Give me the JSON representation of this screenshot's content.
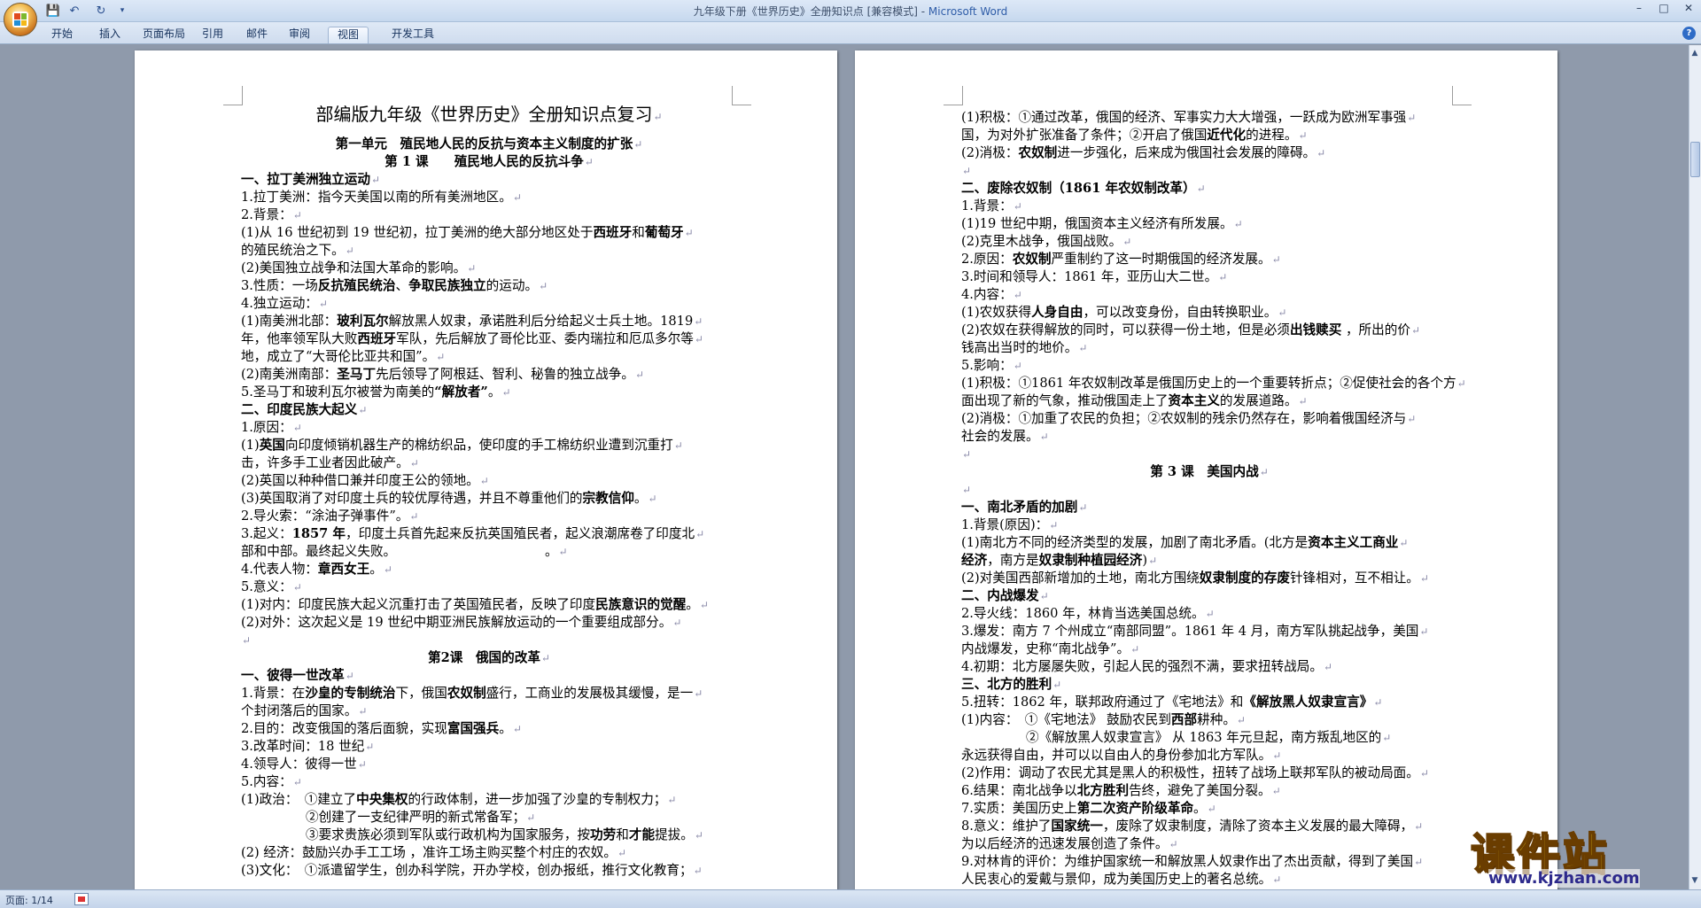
{
  "window": {
    "title": "九年级下册《世界历史》全册知识点 [兼容模式] - ",
    "app_name": "Microsoft Word",
    "minimize": "–",
    "maximize": "□",
    "close": "✕"
  },
  "qat": {
    "save_icon": "💾",
    "undo_icon": "↶",
    "redo_icon": "↻",
    "customize_icon": "▾"
  },
  "ribbon": {
    "tabs": [
      {
        "label": "开始"
      },
      {
        "label": "插入"
      },
      {
        "label": "页面布局"
      },
      {
        "label": "引用"
      },
      {
        "label": "邮件"
      },
      {
        "label": "审阅"
      },
      {
        "label": "视图"
      },
      {
        "label": "开发工具"
      }
    ],
    "active_tab": "视图",
    "help": "?"
  },
  "status": {
    "page": "页面: 1/14"
  },
  "watermark": {
    "main": "课件站",
    "url": "www.kjzhan.com"
  },
  "scroll": {
    "up": "▲",
    "down": "▼"
  },
  "left_page": {
    "title": "部编版九年级《世界历史》全册知识点复习",
    "lines": [
      [
        {
          "t": "第一单元　殖民地人民的反抗与资本主义制度的扩张",
          "b": true
        }
      ],
      [
        {
          "t": "第 1 课　　殖民地人民的反抗斗争",
          "b": true
        }
      ],
      [
        {
          "t": "一、拉丁美洲独立运动",
          "b": true
        }
      ],
      [
        {
          "t": "1.拉丁美洲：指今天美国以南的所有美洲地区。"
        }
      ],
      [
        {
          "t": "2.背景："
        }
      ],
      [
        {
          "t": "(1)从 16 世纪初到 19 世纪初，拉丁美洲的绝大部分地区处于"
        },
        {
          "t": "西班牙",
          "b": true
        },
        {
          "t": "和"
        },
        {
          "t": "葡萄牙",
          "b": true
        }
      ],
      [
        {
          "t": "的殖民统治之下。"
        }
      ],
      [
        {
          "t": "(2)美国独立战争和法国大革命的影响。"
        }
      ],
      [
        {
          "t": "3.性质：一场"
        },
        {
          "t": "反抗殖民统治",
          "b": true
        },
        {
          "t": "、"
        },
        {
          "t": "争取民族独立",
          "b": true
        },
        {
          "t": "的运动。"
        }
      ],
      [
        {
          "t": "4.独立运动："
        }
      ],
      [
        {
          "t": "(1)南美洲北部："
        },
        {
          "t": "玻利瓦尔",
          "b": true
        },
        {
          "t": "解放黑人奴隶，承诺胜利后分给起义士兵土地。1819"
        }
      ],
      [
        {
          "t": "年，他率领军队大败"
        },
        {
          "t": "西班牙",
          "b": true
        },
        {
          "t": "军队，先后解放了哥伦比亚、委内瑞拉和厄瓜多尔等"
        }
      ],
      [
        {
          "t": "地，成立了“大哥伦比亚共和国”。"
        }
      ],
      [
        {
          "t": "(2)南美洲南部："
        },
        {
          "t": "圣马丁",
          "b": true
        },
        {
          "t": "先后领导了阿根廷、智利、秘鲁的独立战争。"
        }
      ],
      [
        {
          "t": "5.圣马丁和玻利瓦尔被誉为南美的"
        },
        {
          "t": "“解放者”",
          "b": true
        },
        {
          "t": "。"
        }
      ],
      [
        {
          "t": "二、印度民族大起义",
          "b": true
        }
      ],
      [
        {
          "t": "1.原因："
        }
      ],
      [
        {
          "t": "(1)"
        },
        {
          "t": "英国",
          "b": true
        },
        {
          "t": "向印度倾销机器生产的棉纺织品，使印度的手工棉纺织业遭到沉重打"
        }
      ],
      [
        {
          "t": "击，许多手工业者因此破产。"
        }
      ],
      [
        {
          "t": "(2)英国以种种借口兼并印度王公的领地。"
        }
      ],
      [
        {
          "t": "(3)英国取消了对印度土兵的较优厚待遇，并且不尊重他们的"
        },
        {
          "t": "宗教信仰",
          "b": true
        },
        {
          "t": "。"
        }
      ],
      [
        {
          "t": "2.导火索：“涂油子弹事件”。"
        }
      ],
      [
        {
          "t": "3.起义："
        },
        {
          "t": "1857 年",
          "b": true
        },
        {
          "t": "，印度土兵首先起来反抗英国殖民者，起义浪潮席卷了印度北"
        }
      ],
      [
        {
          "t": "部和中部。最终起义失败。　　　　　　　　　　　　。"
        }
      ],
      [
        {
          "t": "4.代表人物："
        },
        {
          "t": "章西女王",
          "b": true
        },
        {
          "t": "。"
        }
      ],
      [
        {
          "t": "5.意义："
        }
      ],
      [
        {
          "t": "(1)对内：印度民族大起义沉重打击了英国殖民者，反映了印度"
        },
        {
          "t": "民族意识的觉醒",
          "b": true
        },
        {
          "t": "。"
        }
      ],
      [
        {
          "t": "(2)对外：这次起义是 19 世纪中期亚洲民族解放运动的一个重要组成部分。"
        }
      ],
      [],
      [
        {
          "t": "第2课　俄国的改革",
          "b": true
        }
      ],
      [
        {
          "t": "一、彼得一世改革",
          "b": true
        }
      ],
      [
        {
          "t": "1.背景：在"
        },
        {
          "t": "沙皇的专制统治",
          "b": true
        },
        {
          "t": "下，俄国"
        },
        {
          "t": "农奴制",
          "b": true
        },
        {
          "t": "盛行，工商业的发展极其缓慢，是一"
        }
      ],
      [
        {
          "t": "个封闭落后的国家。"
        }
      ],
      [
        {
          "t": "2.目的：改变俄国的落后面貌，实现"
        },
        {
          "t": "富国强兵",
          "b": true
        },
        {
          "t": "。"
        }
      ],
      [
        {
          "t": "3.改革时间：18 世纪"
        }
      ],
      [
        {
          "t": "4.领导人：彼得一世"
        }
      ],
      [
        {
          "t": "5.内容："
        }
      ],
      [
        {
          "t": "(1)政治：　①建立了"
        },
        {
          "t": "中央集权",
          "b": true
        },
        {
          "t": "的行政体制，进一步加强了沙皇的专制权力；"
        }
      ],
      [
        {
          "t": "　　　　　②创建了一支纪律严明的新式常备军；"
        }
      ],
      [
        {
          "t": "　　　　　③要求贵族必须到军队或行政机构为国家服务，按"
        },
        {
          "t": "功劳",
          "b": true
        },
        {
          "t": "和"
        },
        {
          "t": "才能",
          "b": true
        },
        {
          "t": "提拔。"
        }
      ],
      [
        {
          "t": "(2) 经济：鼓励兴办手工工场 ，准许工场主购买整个村庄的农奴。"
        }
      ],
      [
        {
          "t": "(3)文化：　①派遣留学生，创办科学院，开办学校，创办报纸，推行文化教育；"
        }
      ]
    ],
    "centered": [
      0,
      1,
      29
    ]
  },
  "right_page": {
    "lines": [
      [
        {
          "t": "(1)积极：①通过改革，俄国的经济、军事实力大大增强，一跃成为欧洲军事强"
        }
      ],
      [
        {
          "t": "国，为对外扩张准备了条件；②开启了俄国"
        },
        {
          "t": "近代化",
          "b": true
        },
        {
          "t": "的进程。"
        }
      ],
      [
        {
          "t": "(2)消极："
        },
        {
          "t": "农奴制",
          "b": true
        },
        {
          "t": "进一步强化，后来成为俄国社会发展的障碍。"
        }
      ],
      [],
      [
        {
          "t": "二、废除农奴制（1861 年农奴制改革）",
          "b": true
        }
      ],
      [
        {
          "t": "1.背景："
        }
      ],
      [
        {
          "t": "(1)19 世纪中期，俄国资本主义经济有所发展。"
        }
      ],
      [
        {
          "t": "(2)克里木战争，俄国战败。"
        }
      ],
      [
        {
          "t": "2.原因："
        },
        {
          "t": "农奴制",
          "b": true
        },
        {
          "t": "严重制约了这一时期俄国的经济发展。"
        }
      ],
      [
        {
          "t": "3.时间和领导人：1861 年，亚历山大二世。"
        }
      ],
      [
        {
          "t": "4.内容："
        }
      ],
      [
        {
          "t": "(1)农奴获得"
        },
        {
          "t": "人身自由",
          "b": true
        },
        {
          "t": "，可以改变身份，自由转换职业。"
        }
      ],
      [
        {
          "t": "(2)农奴在获得解放的同时，可以获得一份土地，但是必须"
        },
        {
          "t": "出钱赎买",
          "b": true
        },
        {
          "t": " ，所出的价"
        }
      ],
      [
        {
          "t": "钱高出当时的地价。"
        }
      ],
      [
        {
          "t": "5.影响："
        }
      ],
      [
        {
          "t": "(1)积极：①1861 年农奴制改革是俄国历史上的一个重要转折点；②促使社会的各个方"
        }
      ],
      [
        {
          "t": "面出现了新的气象，推动俄国走上了"
        },
        {
          "t": "资本主义",
          "b": true
        },
        {
          "t": "的发展道路。"
        }
      ],
      [
        {
          "t": "(2)消极：①加重了农民的负担；②农奴制的残余仍然存在，影响着俄国经济与"
        }
      ],
      [
        {
          "t": "社会的发展。"
        }
      ],
      [],
      [
        {
          "t": "第 3 课　美国内战",
          "b": true
        }
      ],
      [],
      [
        {
          "t": "一、南北矛盾的加剧",
          "b": true
        }
      ],
      [
        {
          "t": "1.背景(原因)："
        }
      ],
      [
        {
          "t": "(1)南北方不同的经济类型的发展，加剧了南北矛盾。(北方是"
        },
        {
          "t": "资本主义工商业",
          "b": true
        }
      ],
      [
        {
          "t": "经济",
          "b": true
        },
        {
          "t": "，南方是"
        },
        {
          "t": "奴隶制种植园经济",
          "b": true
        },
        {
          "t": ")"
        }
      ],
      [
        {
          "t": "(2)对美国西部新增加的土地，南北方围绕"
        },
        {
          "t": "奴隶制度的存废",
          "b": true
        },
        {
          "t": "针锋相对，互不相让。"
        }
      ],
      [
        {
          "t": "二、内战爆发",
          "b": true
        }
      ],
      [
        {
          "t": "2.导火线：1860 年，林肯当选美国总统。"
        }
      ],
      [
        {
          "t": "3.爆发：南方 7 个州成立“南部同盟”。1861 年 4 月，南方军队挑起战争，美国"
        }
      ],
      [
        {
          "t": "内战爆发，史称“南北战争”。"
        }
      ],
      [
        {
          "t": "4.初期：北方屡屡失败，引起人民的强烈不满，要求扭转战局。"
        }
      ],
      [
        {
          "t": "三、北方的胜利",
          "b": true
        }
      ],
      [
        {
          "t": "5.扭转：1862 年，联邦政府通过了《宅地法》和"
        },
        {
          "t": "《解放黑人奴隶宣言》",
          "b": true
        }
      ],
      [
        {
          "t": "(1)内容：　①《宅地法》 鼓励农民到"
        },
        {
          "t": "西部",
          "b": true
        },
        {
          "t": "耕种。"
        }
      ],
      [
        {
          "t": "　　　　　②《解放黑人奴隶宣言》 从 1863 年元旦起，南方叛乱地区的"
        }
      ],
      [
        {
          "t": "永远获得自由，并可以以自由人的身份参加北方军队。"
        }
      ],
      [
        {
          "t": "(2)作用：调动了农民尤其是黑人的积极性，扭转了战场上联邦军队的被动局面。"
        }
      ],
      [
        {
          "t": "6.结果：南北战争以"
        },
        {
          "t": "北方胜利",
          "b": true
        },
        {
          "t": "告终，避免了美国分裂。"
        }
      ],
      [
        {
          "t": "7.实质：美国历史上"
        },
        {
          "t": "第二次资产阶级革命",
          "b": true
        },
        {
          "t": "。"
        }
      ],
      [
        {
          "t": "8.意义：维护了"
        },
        {
          "t": "国家统一",
          "b": true
        },
        {
          "t": "，废除了奴隶制度，清除了资本主义发展的最大障碍，"
        }
      ],
      [
        {
          "t": "为以后经济的迅速发展创造了条件。"
        }
      ],
      [
        {
          "t": "9.对林肯的评价：为维护国家统一和解放黑人奴隶作出了杰出贡献，得到了美国"
        }
      ],
      [
        {
          "t": "人民衷心的爱戴与景仰，成为美国历史上的著名总统。"
        }
      ]
    ],
    "centered": [
      20
    ]
  }
}
